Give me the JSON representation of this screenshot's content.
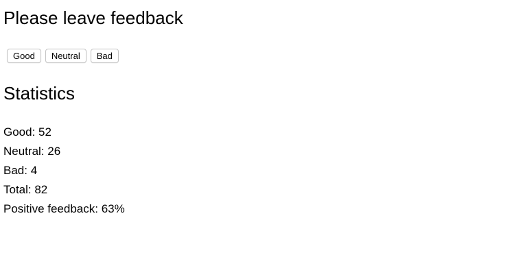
{
  "feedback": {
    "title": "Please leave feedback",
    "buttons": {
      "good": "Good",
      "neutral": "Neutral",
      "bad": "Bad"
    }
  },
  "statistics": {
    "title": "Statistics",
    "lines": {
      "good": "Good: 52",
      "neutral": "Neutral: 26",
      "bad": "Bad: 4",
      "total": "Total: 82",
      "positive": "Positive feedback: 63%"
    }
  }
}
